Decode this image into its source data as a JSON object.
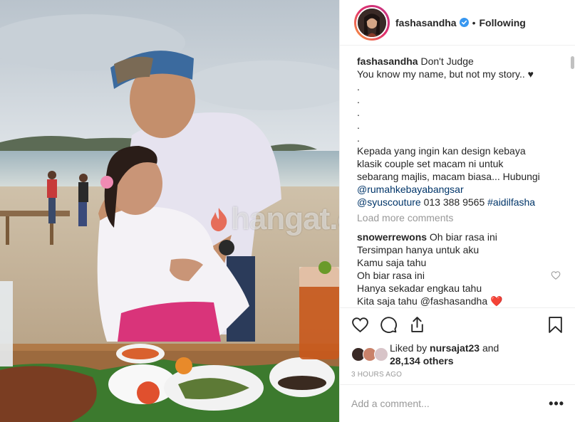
{
  "post": {
    "username": "fashasandha",
    "follow_separator": "•",
    "follow_status": "Following",
    "watermark": "hangat.com"
  },
  "caption": {
    "username": "fashasandha",
    "lines": [
      "Don't Judge",
      "You know my name, but not my story.. ♥",
      ".",
      ".",
      ".",
      ".",
      ".",
      "Kepada yang ingin kan design kebaya",
      "klasik couple set macam ni untuk",
      "sebarang majlis, macam biasa... Hubungi"
    ],
    "mention1": "@rumahkebayabangsar",
    "mention2": "@syuscouture",
    "phone": " 013 388 9565 ",
    "hashtag": "#aidilfasha"
  },
  "load_more": "Load more comments",
  "comment": {
    "username": "snowerrewons",
    "lines": [
      "Oh biar rasa ini",
      "Tersimpan hanya untuk aku",
      "Kamu saja tahu",
      "Oh biar rasa ini",
      "Hanya sekadar engkau tahu",
      "Kita saja tahu @fashasandha ❤️"
    ]
  },
  "likes": {
    "prefix": "Liked by ",
    "user": "nursajat23",
    "mid": " and",
    "count": "28,134 others"
  },
  "timestamp": "3 HOURS AGO",
  "add_comment": {
    "placeholder": "Add a comment...",
    "more": "•••"
  },
  "icons": {
    "verified": "verified-badge-icon",
    "like": "heart-icon",
    "comment": "comment-bubble-icon",
    "share": "share-icon",
    "save": "bookmark-icon"
  },
  "colors": {
    "verified": "#3897f0",
    "link": "#003569",
    "muted": "#999999",
    "border": "#efefef",
    "heart_red": "#ed4956"
  }
}
